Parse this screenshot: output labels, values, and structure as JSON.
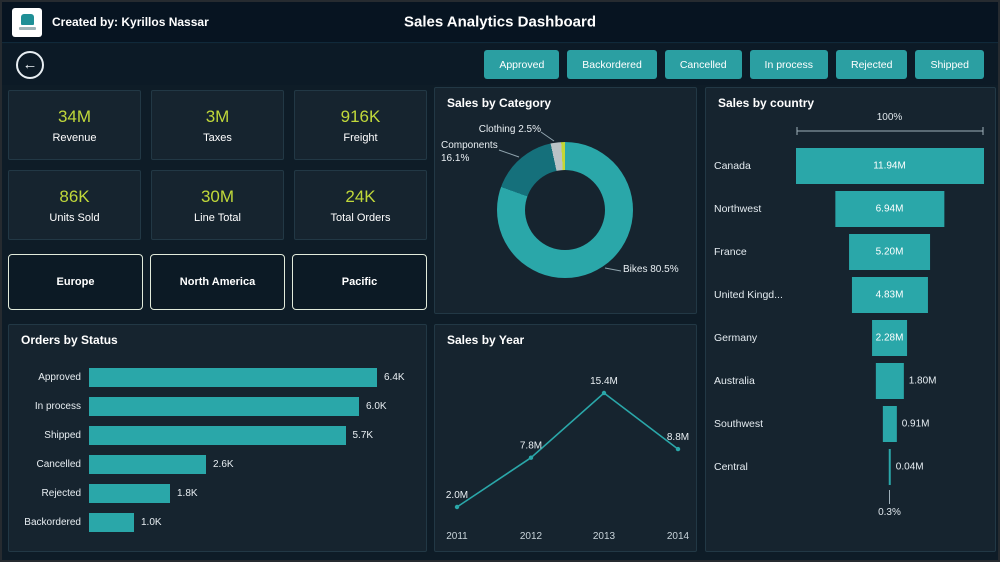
{
  "colors": {
    "accent_teal": "#2aa7a9",
    "kpi_green": "#c0d83a",
    "panel_bg": "#16242f",
    "page_bg": "#0e1c27",
    "header_bg": "#071421"
  },
  "header": {
    "created_by": "Created by: Kyrillos Nassar",
    "title": "Sales Analytics Dashboard"
  },
  "filters": {
    "buttons": [
      "Approved",
      "Backordered",
      "Cancelled",
      "In process",
      "Rejected",
      "Shipped"
    ]
  },
  "kpis": [
    {
      "value": "34M",
      "label": "Revenue"
    },
    {
      "value": "3M",
      "label": "Taxes"
    },
    {
      "value": "916K",
      "label": "Freight"
    },
    {
      "value": "86K",
      "label": "Units Sold"
    },
    {
      "value": "30M",
      "label": "Line Total"
    },
    {
      "value": "24K",
      "label": "Total Orders"
    }
  ],
  "regions": [
    "Europe",
    "North America",
    "Pacific"
  ],
  "chart_data": [
    {
      "type": "bar",
      "orientation": "horizontal",
      "title": "Orders by Status",
      "categories": [
        "Approved",
        "In process",
        "Shipped",
        "Cancelled",
        "Rejected",
        "Backordered"
      ],
      "values": [
        6.4,
        6.0,
        5.7,
        2.6,
        1.8,
        1.0
      ],
      "value_labels": [
        "6.4K",
        "6.0K",
        "5.7K",
        "2.6K",
        "1.8K",
        "1.0K"
      ],
      "color": "#2aa7a9"
    },
    {
      "type": "pie",
      "title": "Sales by Category",
      "donut": true,
      "slices": [
        {
          "label": "Bikes",
          "pct": 80.5,
          "color": "#2aa7a9"
        },
        {
          "label": "Components",
          "pct": 16.1,
          "color": "#15707b"
        },
        {
          "label": "Clothing",
          "pct": 2.5,
          "color": "#b9c2c6"
        },
        {
          "label": "",
          "pct": 0.9,
          "color": "#c3d735"
        }
      ],
      "callouts": [
        "Clothing 2.5%",
        "Components 16.1%",
        "Bikes 80.5%"
      ]
    },
    {
      "type": "line",
      "title": "Sales by Year",
      "x": [
        "2011",
        "2012",
        "2013",
        "2014"
      ],
      "values": [
        2.0,
        7.8,
        15.4,
        8.8
      ],
      "point_labels": [
        "2.0M",
        "7.8M",
        "15.4M",
        "8.8M"
      ],
      "ylim": [
        0,
        16
      ],
      "color": "#2aa7a9"
    },
    {
      "type": "funnel",
      "title": "Sales by country",
      "categories": [
        "Canada",
        "Northwest",
        "France",
        "United Kingd...",
        "Germany",
        "Australia",
        "Southwest",
        "Central"
      ],
      "values": [
        11.94,
        6.94,
        5.2,
        4.83,
        2.28,
        1.8,
        0.91,
        0.04
      ],
      "value_labels": [
        "11.94M",
        "6.94M",
        "5.20M",
        "4.83M",
        "2.28M",
        "1.80M",
        "0.91M",
        "0.04M"
      ],
      "top_label": "100%",
      "bottom_label": "0.3%",
      "color": "#2aa7a9"
    }
  ]
}
